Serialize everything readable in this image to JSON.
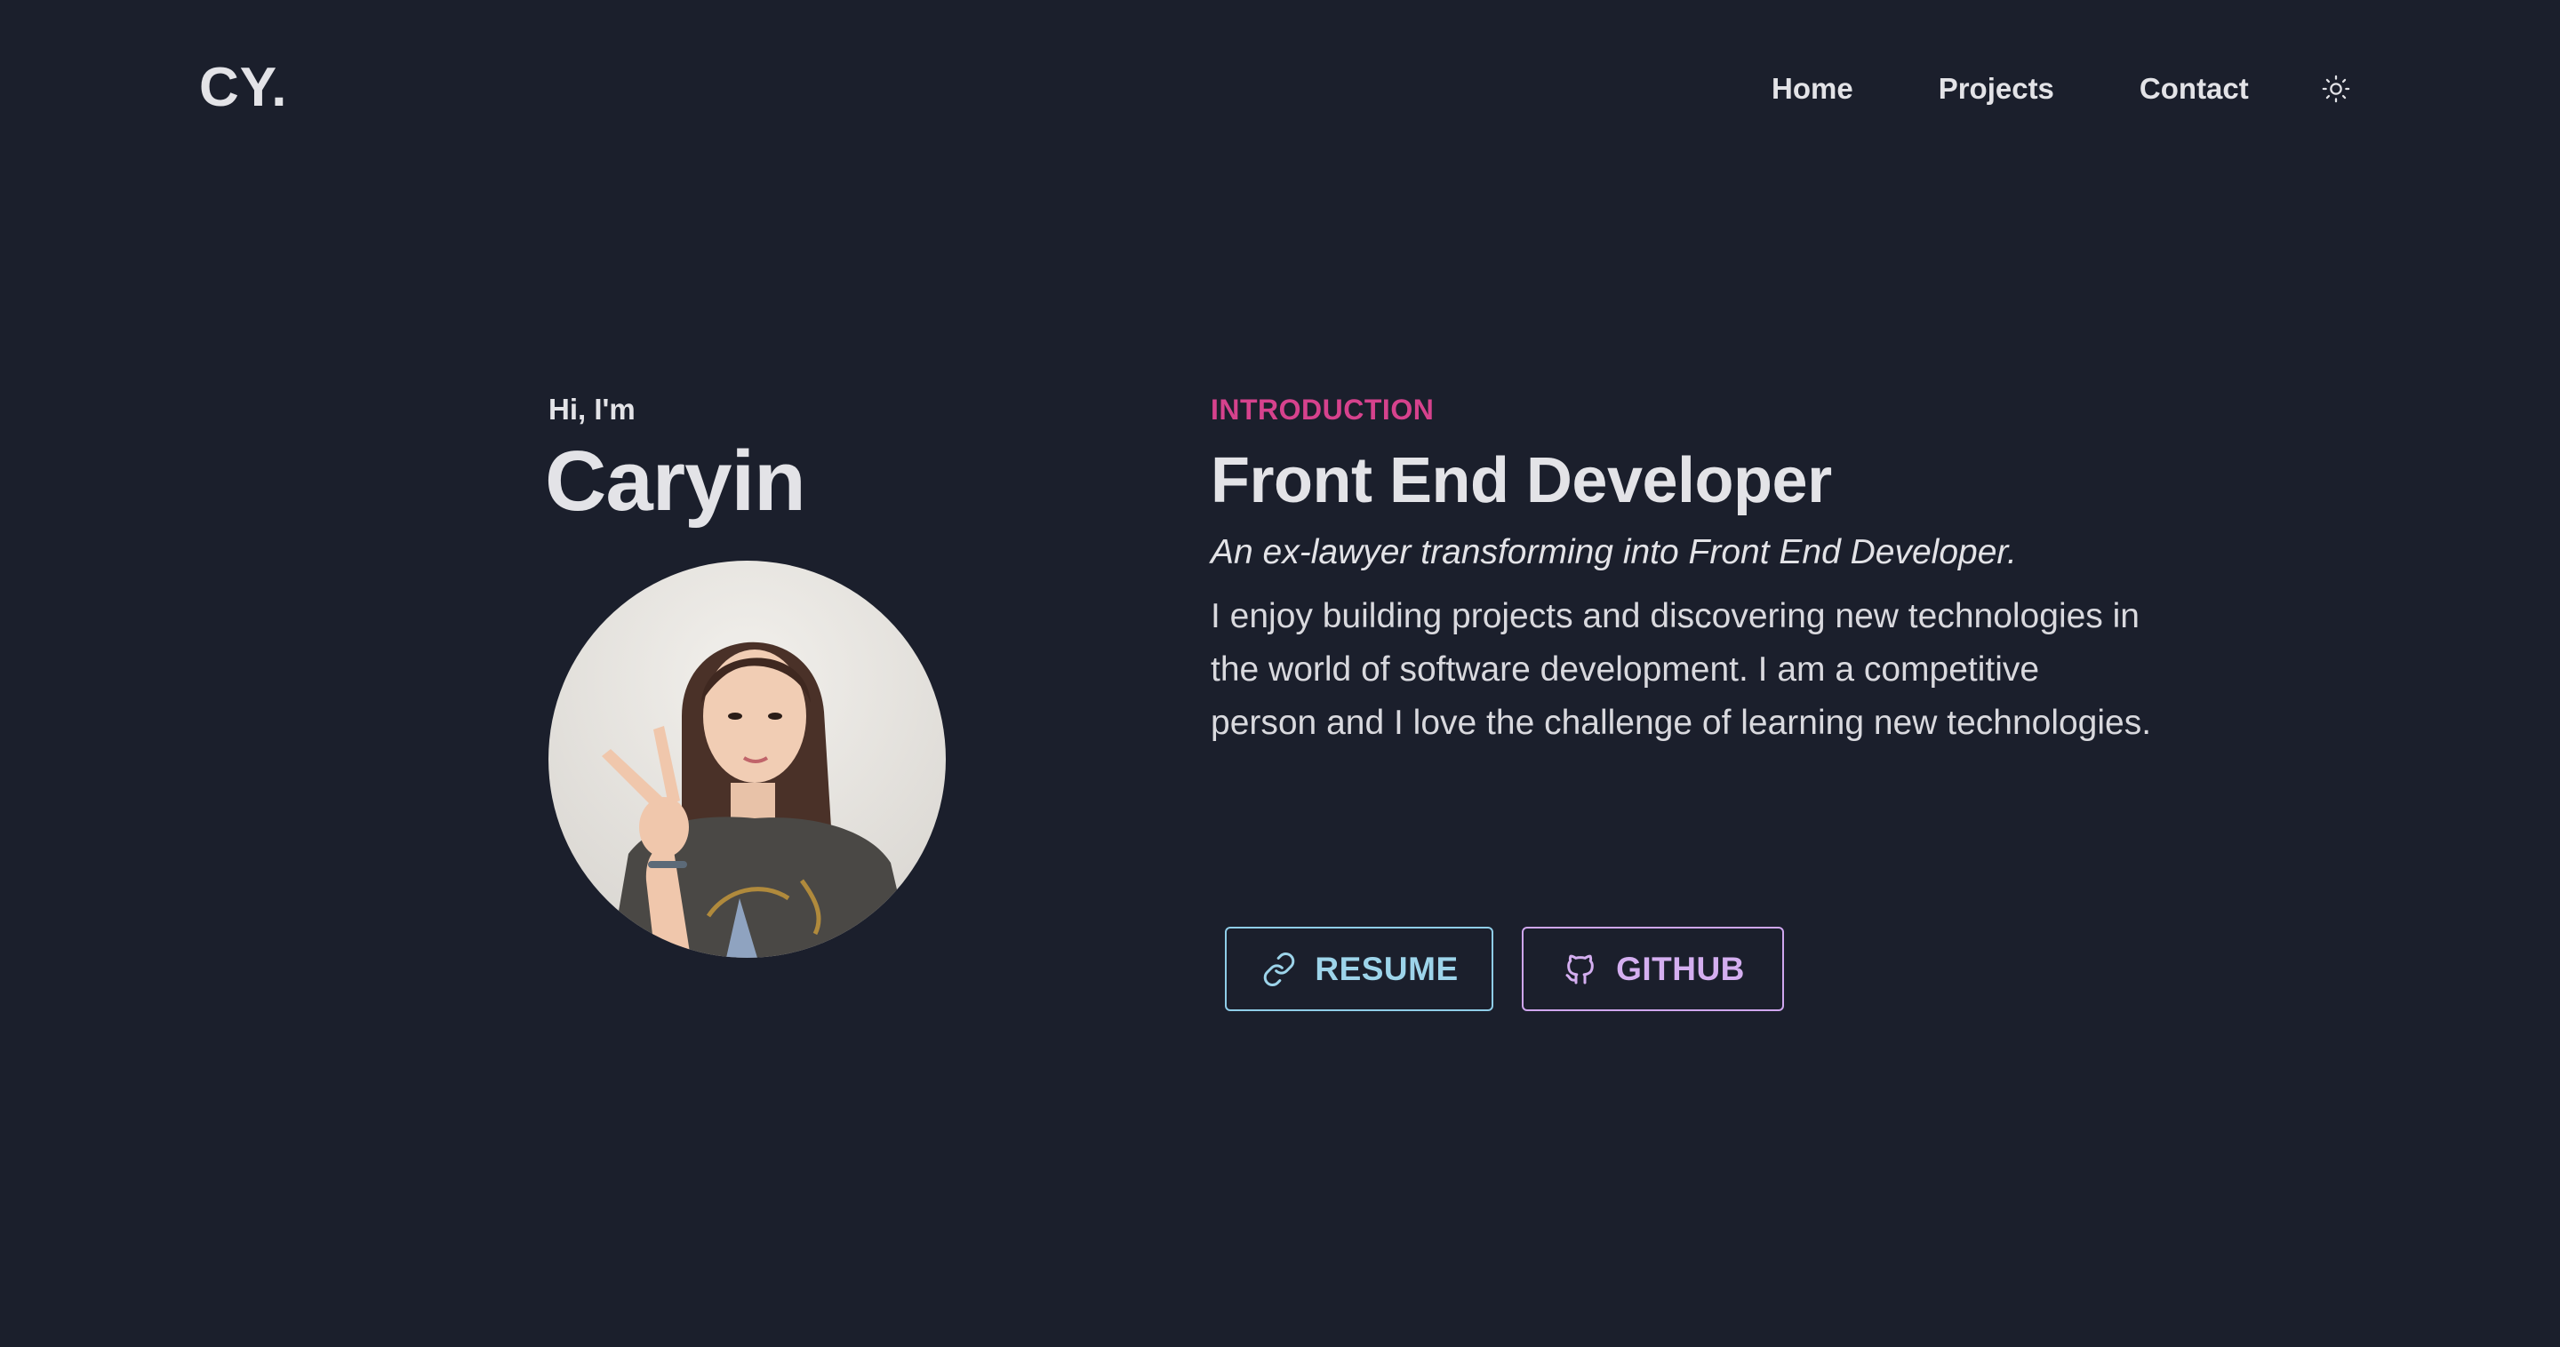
{
  "header": {
    "logo": "CY.",
    "nav": {
      "home": "Home",
      "projects": "Projects",
      "contact": "Contact"
    },
    "theme_toggle_icon": "sun-icon"
  },
  "hero": {
    "greeting": "Hi, I'm",
    "name": "Caryin",
    "avatar_alt": "profile-photo"
  },
  "intro": {
    "eyebrow": "INTRODUCTION",
    "role": "Front End Developer",
    "tagline": "An ex-lawyer transforming into Front End Developer.",
    "bio": "I enjoy building projects and discovering new technologies in the world of software development. I am a competitive person and I love the challenge of learning new technologies."
  },
  "buttons": {
    "resume": {
      "label": "RESUME",
      "icon": "link-icon"
    },
    "github": {
      "label": "GITHUB",
      "icon": "github-icon"
    }
  },
  "colors": {
    "background": "#1b1f2c",
    "text": "#e3e3e7",
    "accent_pink": "#d6428d",
    "resume_blue": "#9dd4ea",
    "github_purple": "#d4aef0"
  }
}
